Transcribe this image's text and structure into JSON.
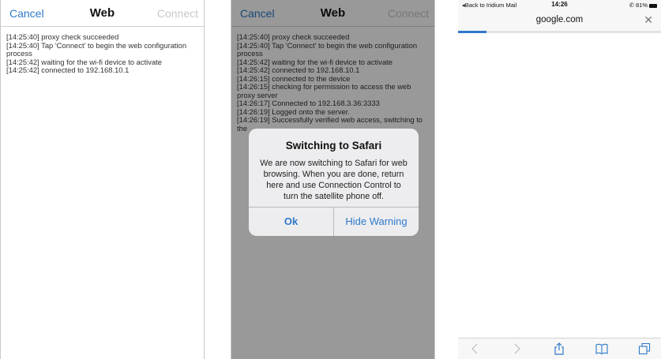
{
  "screen1": {
    "nav": {
      "cancel": "Cancel",
      "title": "Web",
      "connect": "Connect"
    },
    "log": [
      "[14:25:40] proxy check succeeded",
      "[14:25:40] Tap 'Connect' to begin the web configuration process",
      "[14:25:42] waiting for the wi-fi device to activate",
      "[14:25:42] connected to 192.168.10.1"
    ]
  },
  "screen2": {
    "nav": {
      "cancel": "Cancel",
      "title": "Web",
      "connect": "Connect"
    },
    "log": [
      "[14:25:40] proxy check succeeded",
      "[14:25:40] Tap 'Connect' to begin the web configuration process",
      "[14:25:42] waiting for the wi-fi device to activate",
      "[14:25:42] connected to 192.168.10.1",
      "[14:26:15] connected to the device",
      "[14:26:15] checking for permission to access the web proxy server",
      "[14:26:17] Connected to 192.168.3.36:3333",
      "[14:26:19] Logged onto the server.",
      "[14:26:19] Successfully verified web access, switching to the"
    ],
    "alert": {
      "title": "Switching to Safari",
      "message": "We are now switching to Safari for web browsing. When you are done, return here and use Connection Control to turn the satellite phone off.",
      "ok": "Ok",
      "hide_warning": "Hide Warning"
    }
  },
  "screen3": {
    "status": {
      "back": "◂Back to Iridium Mail",
      "time": "14:26",
      "battery": "✆ 81%"
    },
    "url": "google.com",
    "progress": 0.14,
    "colors": {
      "accent": "#2f79c9"
    },
    "toolbar_icons": [
      "back-icon",
      "forward-icon",
      "share-icon",
      "bookmarks-icon",
      "tabs-icon"
    ]
  }
}
